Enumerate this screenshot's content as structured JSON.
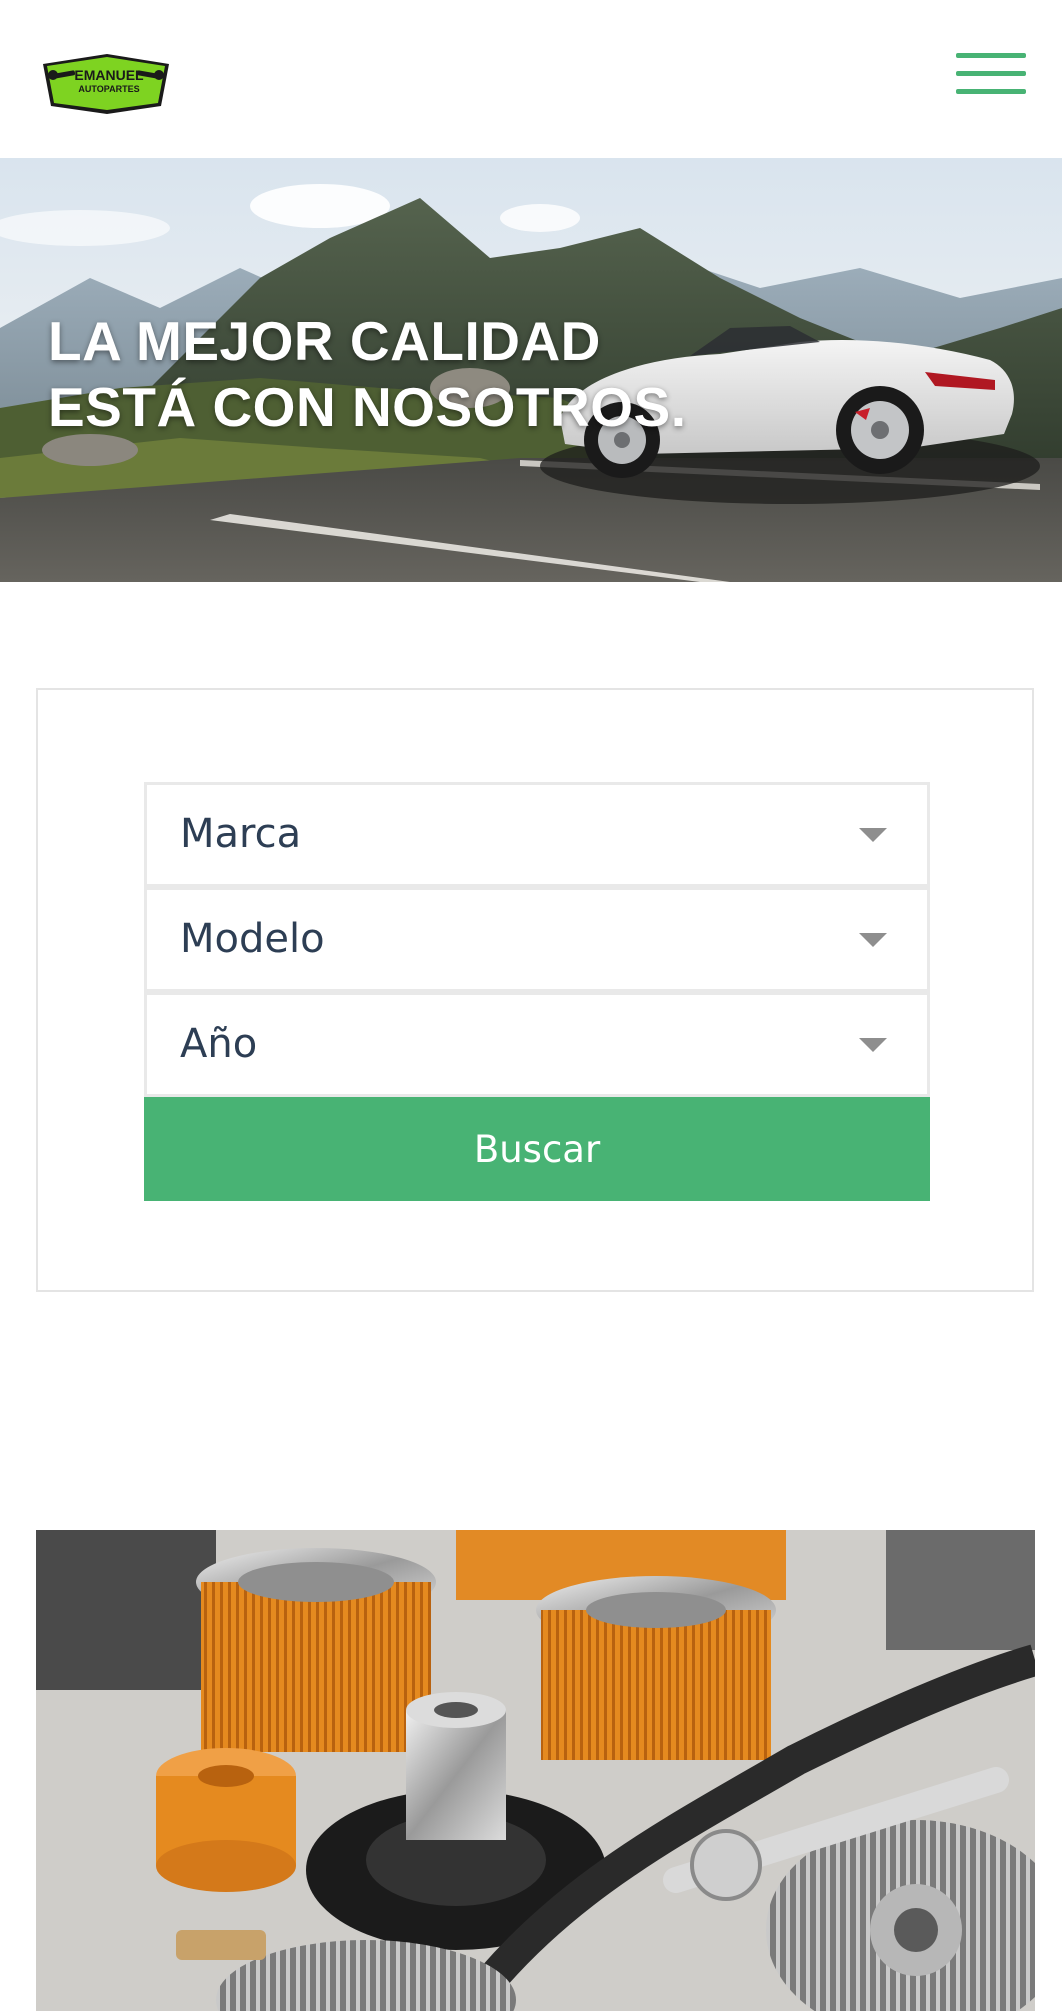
{
  "header": {
    "logo": {
      "line1": "EMANUEL",
      "line2": "AUTOPARTES"
    },
    "menu_icon": "hamburger-menu-icon"
  },
  "hero": {
    "title_line1": "LA MEJOR CALIDAD",
    "title_line2": "ESTÁ CON NOSOTROS."
  },
  "search": {
    "brand_select": {
      "value": "Marca"
    },
    "model_select": {
      "value": "Modelo"
    },
    "year_select": {
      "value": "Año"
    },
    "button_label": "Buscar"
  },
  "colors": {
    "accent": "#48b374",
    "text": "#2d3e54",
    "logo_green": "#7ed321"
  }
}
